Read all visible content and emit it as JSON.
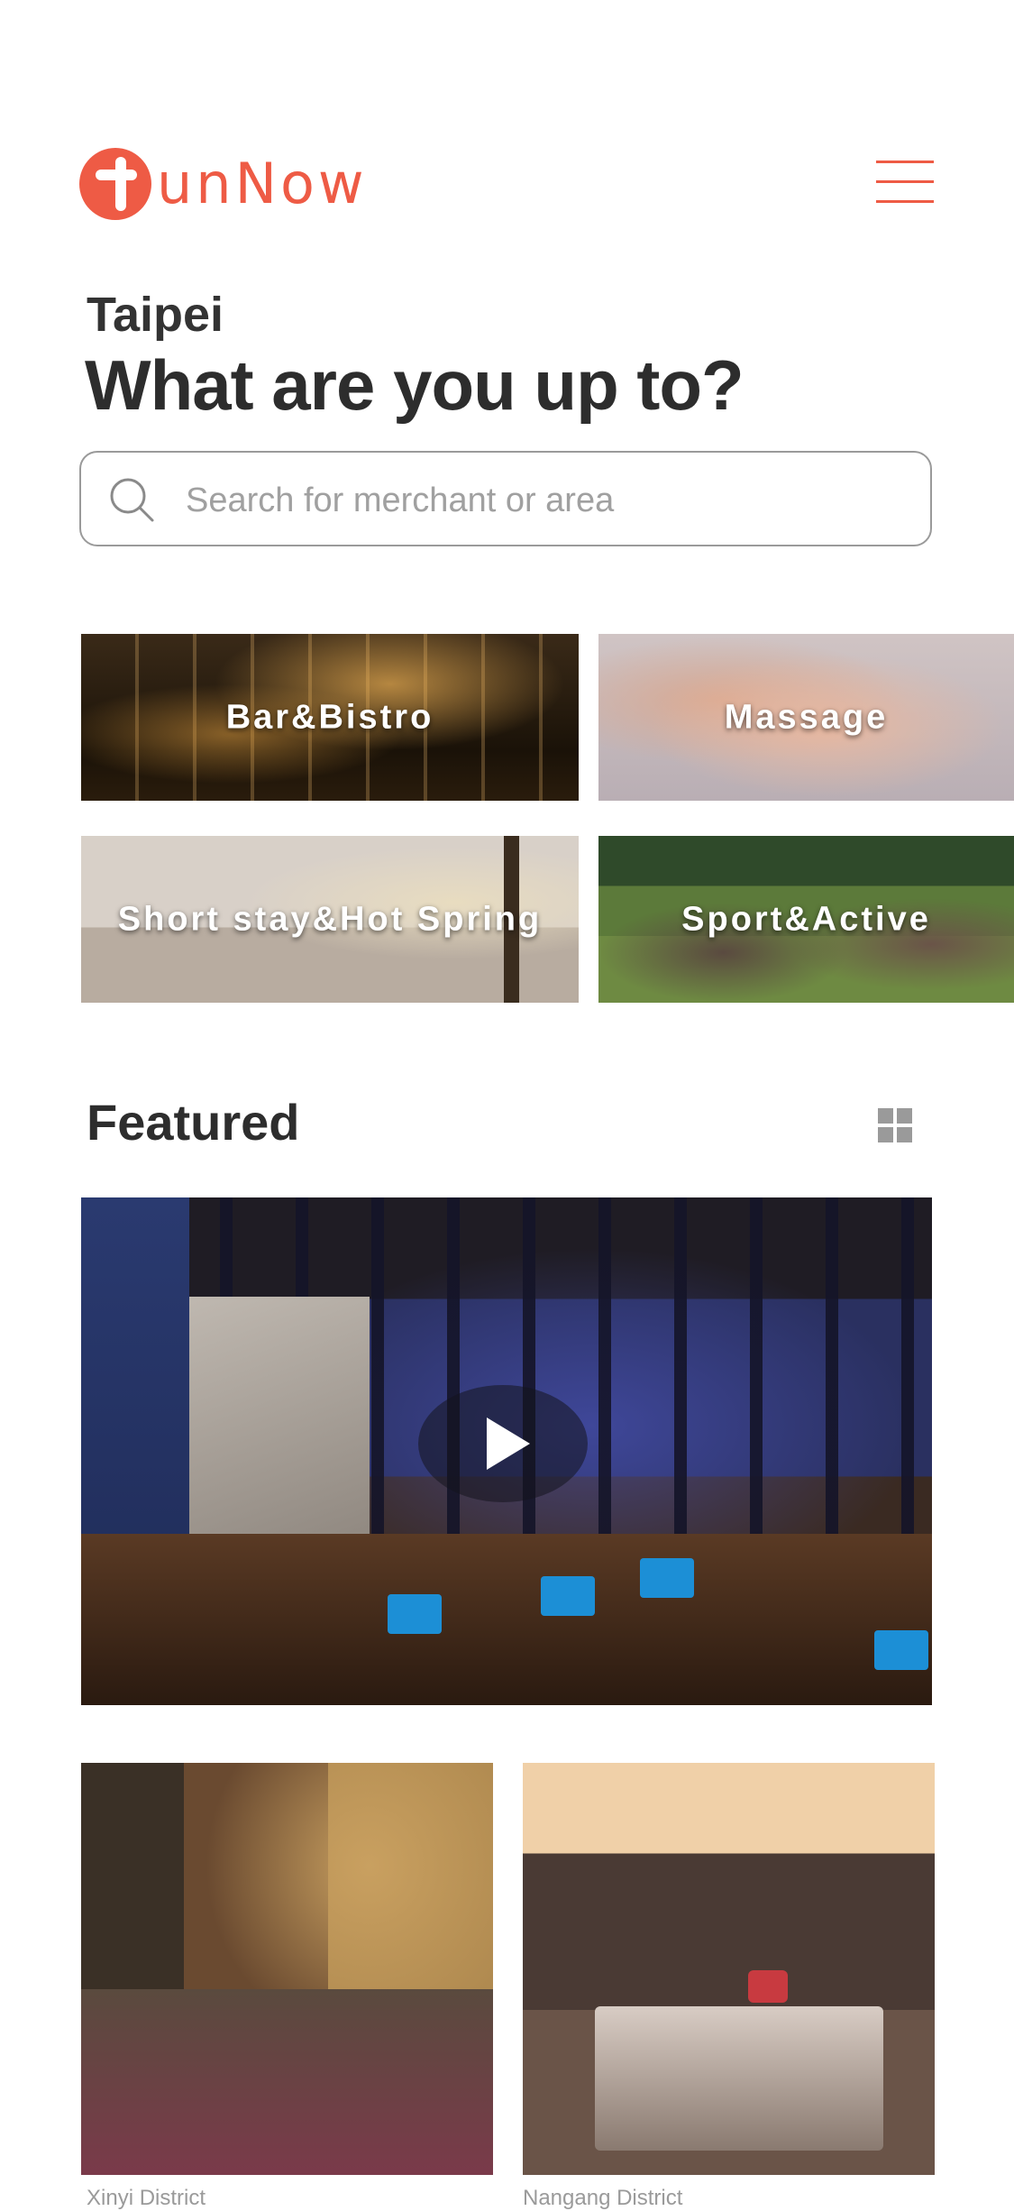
{
  "brand": {
    "name": "unNow",
    "color": "#ee5b45"
  },
  "header": {
    "menu_icon": "hamburger-menu-icon"
  },
  "location": {
    "city": "Taipei"
  },
  "headline": "What are you up to?",
  "search": {
    "placeholder": "Search for merchant or area",
    "value": "",
    "icon": "search-icon"
  },
  "categories": [
    {
      "label": "Bar&Bistro"
    },
    {
      "label": "Massage"
    },
    {
      "label": "Short stay&Hot Spring"
    },
    {
      "label": "Sport&Active"
    }
  ],
  "featured": {
    "title": "Featured",
    "view_toggle_icon": "grid-view-icon",
    "hero_video_icon": "play-icon",
    "cards": [
      {
        "district": "Xinyi District"
      },
      {
        "district": "Nangang District"
      }
    ]
  }
}
